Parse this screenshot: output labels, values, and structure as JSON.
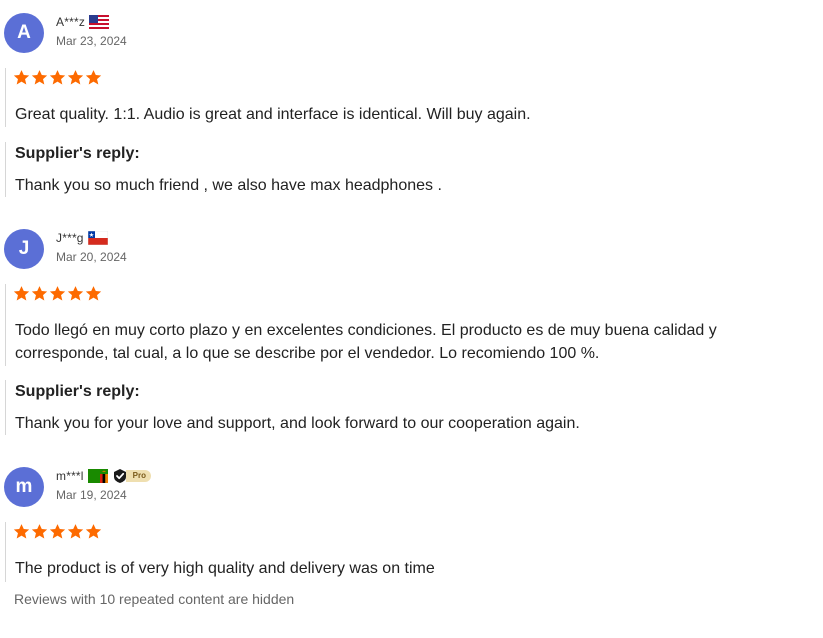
{
  "colors": {
    "avatar": "#5b6fd6",
    "star": "#fd6a00",
    "text": "#222222",
    "muted": "#666666"
  },
  "reviews": [
    {
      "avatar_letter": "A",
      "user": "A***z",
      "flag": "us-flag-icon",
      "date": "Mar 23, 2024",
      "rating": 5,
      "text": "Great quality. 1:1. Audio is great and interface is identical. Will buy again.",
      "reply_title": "Supplier's reply:",
      "reply_text": "Thank you so much friend , we also have max headphones ."
    },
    {
      "avatar_letter": "J",
      "user": "J***g",
      "flag": "chile-flag-icon",
      "date": "Mar 20, 2024",
      "rating": 5,
      "text_lines": [
        "Todo llegó en muy corto plazo y en excelentes condiciones. El producto es de muy buena calidad y",
        "corresponde, tal cual, a lo que se describe por el vendedor. Lo recomiendo 100 %."
      ],
      "reply_title": "Supplier's reply:",
      "reply_text": "Thank you for your love and support, and look forward to our cooperation again."
    },
    {
      "avatar_letter": "m",
      "user": "m***l",
      "flag": "zambia-flag-icon",
      "badge": "Pro",
      "date": "Mar 19, 2024",
      "rating": 5,
      "text": "The product is of very high quality and delivery was on time"
    }
  ],
  "hidden_note": "Reviews with 10 repeated content are hidden"
}
